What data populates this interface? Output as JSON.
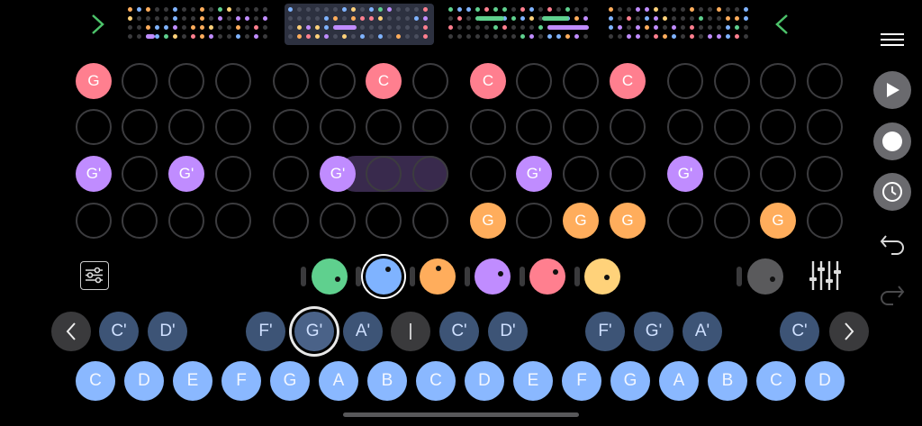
{
  "overview": {
    "left_arrow": "chevron-right",
    "right_arrow": "chevron-left"
  },
  "grid": {
    "rows": [
      [
        "G",
        "",
        "",
        "",
        "",
        "",
        "C",
        "",
        "C",
        "",
        "",
        "C",
        "",
        "",
        "",
        ""
      ],
      [
        "",
        "",
        "",
        "",
        "",
        "",
        "",
        "",
        "",
        "",
        "",
        "",
        "",
        "",
        "",
        ""
      ],
      [
        "G'",
        "",
        "G'",
        "",
        "",
        "G'",
        "",
        "",
        "",
        "G'",
        "",
        "",
        "G'",
        "",
        "",
        ""
      ],
      [
        "",
        "",
        "",
        "",
        "",
        "",
        "",
        "",
        "G",
        "",
        "G",
        "G",
        "",
        "",
        "G",
        ""
      ]
    ]
  },
  "colors": {
    "pink": "#ff7f8f",
    "purple": "#c08cff",
    "orange": "#ffad5c",
    "yellow": "#ffd27a",
    "green": "#5fd08e",
    "blue": "#7fb3ff",
    "gray": "#5a5a5c"
  },
  "transport": {
    "menu_icon": "hamburger-menu",
    "play_icon": "play",
    "record_icon": "record",
    "history_icon": "clock",
    "undo_icon": "undo",
    "redo_icon": "redo"
  },
  "settings_icon": "sliders-box",
  "mixer_icon": "mixer-sliders",
  "chord_row": {
    "prev": "‹",
    "next": "›",
    "divider": "|",
    "keys": [
      "C'",
      "D'",
      "F'",
      "G'",
      "A'",
      "C'",
      "D'",
      "F'",
      "G'",
      "A'",
      "C'"
    ]
  },
  "note_row": [
    "C",
    "D",
    "E",
    "F",
    "G",
    "A",
    "B",
    "C",
    "D",
    "E",
    "F",
    "G",
    "A",
    "B",
    "C",
    "D"
  ]
}
